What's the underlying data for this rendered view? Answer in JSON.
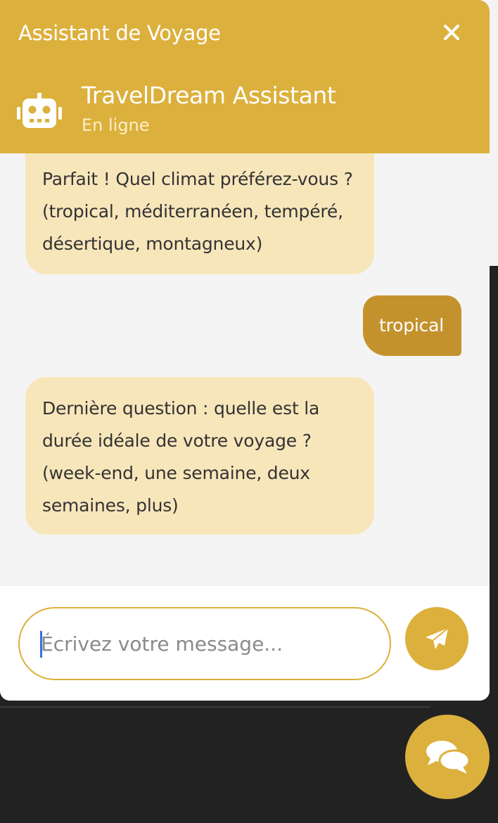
{
  "widget": {
    "title": "Assistant de Voyage",
    "close_icon": "close-icon",
    "agent": {
      "icon": "robot-icon",
      "name": "TravelDream Assistant",
      "status": "En ligne"
    }
  },
  "messages": [
    {
      "sender": "bot",
      "text": "Parfait ! Quel climat préférez-vous ? (tropical, méditerranéen, tempéré, désertique, montagneux)"
    },
    {
      "sender": "user",
      "text": "tropical"
    },
    {
      "sender": "bot",
      "text": "Dernière question : quelle est la durée idéale de votre voyage ? (week-end, une semaine, deux semaines, plus)"
    }
  ],
  "composer": {
    "placeholder": "Écrivez votre message...",
    "value": "",
    "send_icon": "paper-plane-icon"
  },
  "launcher": {
    "icon": "chat-bubbles-icon"
  },
  "colors": {
    "accent": "#dcb03c",
    "user_bubble": "#c4922c",
    "bot_bubble": "#f8e6bb",
    "dark_background": "#222222"
  }
}
